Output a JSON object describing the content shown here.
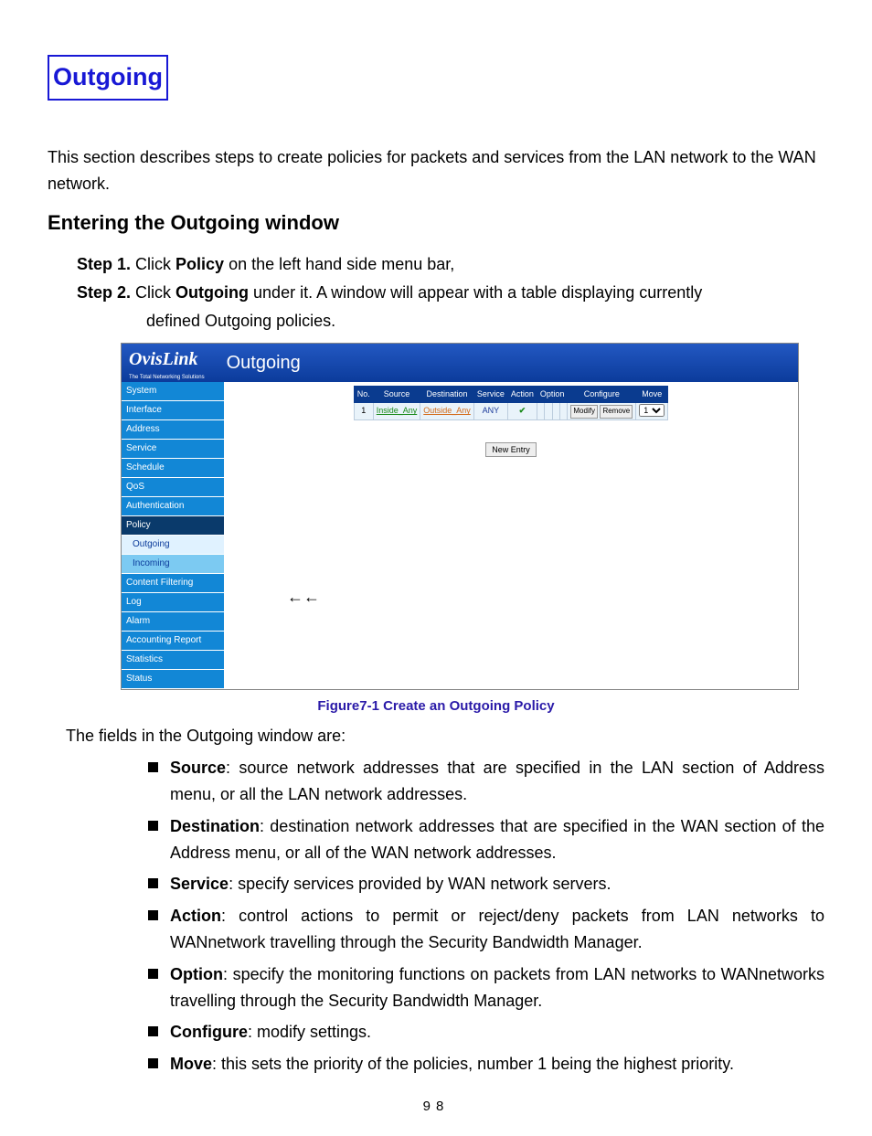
{
  "title": "Outgoing",
  "intro": "This section describes steps to create policies for packets and services from the LAN network to the WAN network.",
  "subtitle": "Entering the Outgoing window",
  "steps": {
    "s1_label": "Step 1.",
    "s1_pre": "Click ",
    "s1_bold": "Policy",
    "s1_post": " on the left hand side menu bar,",
    "s2_label": "Step 2.",
    "s2_pre": "Click ",
    "s2_bold": "Outgoing",
    "s2_post": " under it.    A window will appear with a table displaying currently",
    "s2_cont": "defined Outgoing policies."
  },
  "screenshot": {
    "brand": "OvisLink",
    "tagline": "The Total Networking Solutions",
    "page_name": "Outgoing",
    "menu": {
      "m0": "System",
      "m1": "Interface",
      "m2": "Address",
      "m3": "Service",
      "m4": "Schedule",
      "m5": "QoS",
      "m6": "Authentication",
      "m7": "Policy",
      "s0": "Outgoing",
      "s1": "Incoming",
      "m8": "Content Filtering",
      "m9": "Log",
      "m10": "Alarm",
      "m11": "Accounting Report",
      "m12": "Statistics",
      "m13": "Status"
    },
    "table": {
      "h_no": "No.",
      "h_source": "Source",
      "h_dest": "Destination",
      "h_service": "Service",
      "h_action": "Action",
      "h_option": "Option",
      "h_configure": "Configure",
      "h_move": "Move",
      "r1_no": "1",
      "r1_source": "Inside_Any",
      "r1_dest": "Outside_Any",
      "r1_service": "ANY",
      "r1_action": "✔",
      "r1_option": " ",
      "r1_cfg1": "Modify",
      "r1_cfg2": "Remove",
      "r1_move": "1"
    },
    "new_entry": "New Entry",
    "arrows": "←←"
  },
  "figure_caption": "Figure7-1 Create an Outgoing Policy",
  "fields_intro": "The fields in the Outgoing window are:",
  "fields": {
    "f0_b": "Source",
    "f0_t": ": source network addresses that are specified in the LAN section of Address menu, or all the LAN network addresses.",
    "f1_b": "Destination",
    "f1_t": ": destination network addresses that are specified in the WAN section of the Address menu, or all of the WAN network addresses.",
    "f2_b": "Service",
    "f2_t": ": specify services provided by WAN network servers.",
    "f3_b": "Action",
    "f3_t": ": control actions to permit or reject/deny packets from LAN networks to WANnetwork travelling through the Security Bandwidth Manager.",
    "f4_b": "Option",
    "f4_t": ": specify the monitoring functions on packets from LAN networks to WANnetworks travelling through the Security Bandwidth Manager.",
    "f5_b": "Configure",
    "f5_t": ": modify settings.",
    "f6_b": "Move",
    "f6_t": ": this sets the priority of the policies, number 1 being the highest priority."
  },
  "page_number": "98"
}
